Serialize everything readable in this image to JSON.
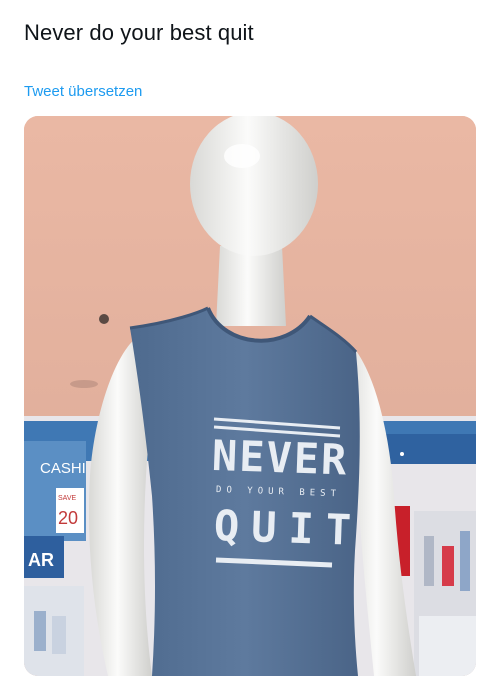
{
  "tweet": {
    "text": "Never do your best quit",
    "translate_link": "Tweet übersetzen"
  },
  "media": {
    "shirt_print": {
      "line1": "NEVER",
      "line2": "DO YOUR BEST",
      "line3": "QUIT"
    },
    "store_signs": {
      "cashier": "CASHI",
      "save": "SAVE",
      "save_number": "20",
      "clearance": "AR"
    },
    "colors": {
      "ceiling": "#e6b4a2",
      "shirt": "#5a7599",
      "mannequin": "#f2f2f0",
      "store_blue": "#3f78b4",
      "link": "#1d9bf0"
    }
  }
}
